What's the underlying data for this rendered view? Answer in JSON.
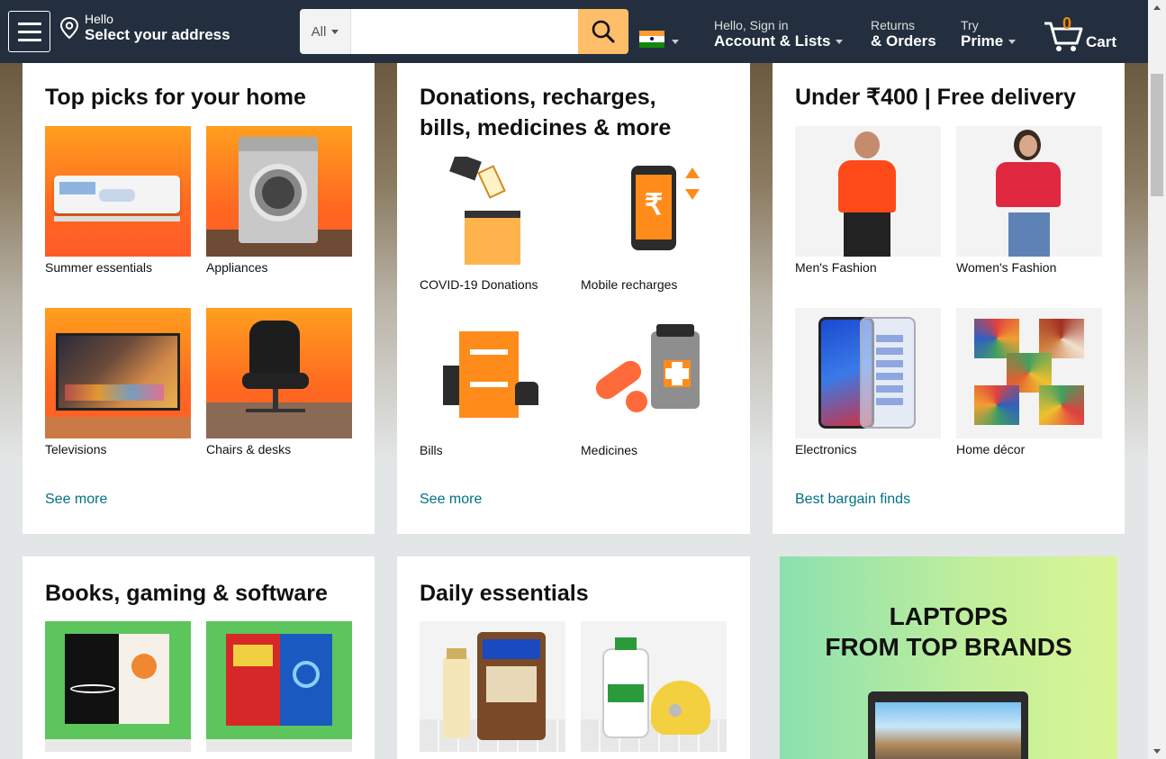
{
  "header": {
    "address_greeting": "Hello",
    "address_label": "Select your address",
    "search_category": "All",
    "search_placeholder": "",
    "account_small": "Hello, Sign in",
    "account_big": "Account & Lists",
    "returns_small": "Returns",
    "returns_big": "& Orders",
    "prime_small": "Try",
    "prime_big": "Prime",
    "cart_count": "0",
    "cart_label": "Cart",
    "colors": {
      "bar": "#232f3e",
      "search_button": "#febd69",
      "cart_count": "#f08804"
    }
  },
  "cards": {
    "home": {
      "title": "Top picks for your home",
      "tiles": [
        "Summer essentials",
        "Appliances",
        "Televisions",
        "Chairs & desks"
      ],
      "link": "See more"
    },
    "donations": {
      "title_line1": "Donations, recharges,",
      "title_line2": "bills, medicines & more",
      "tiles": [
        "COVID-19 Donations",
        "Mobile recharges",
        "Bills",
        "Medicines"
      ],
      "link": "See more"
    },
    "under400": {
      "title": "Under ₹400 | Free delivery",
      "tiles": [
        "Men's Fashion",
        "Women's Fashion",
        "Electronics",
        "Home décor"
      ],
      "link": "Best bargain finds"
    },
    "books": {
      "title": "Books, gaming & software"
    },
    "daily": {
      "title": "Daily essentials"
    }
  },
  "ad": {
    "line1": "LAPTOPS",
    "line2": "FROM TOP BRANDS"
  },
  "link_color": "#007185"
}
